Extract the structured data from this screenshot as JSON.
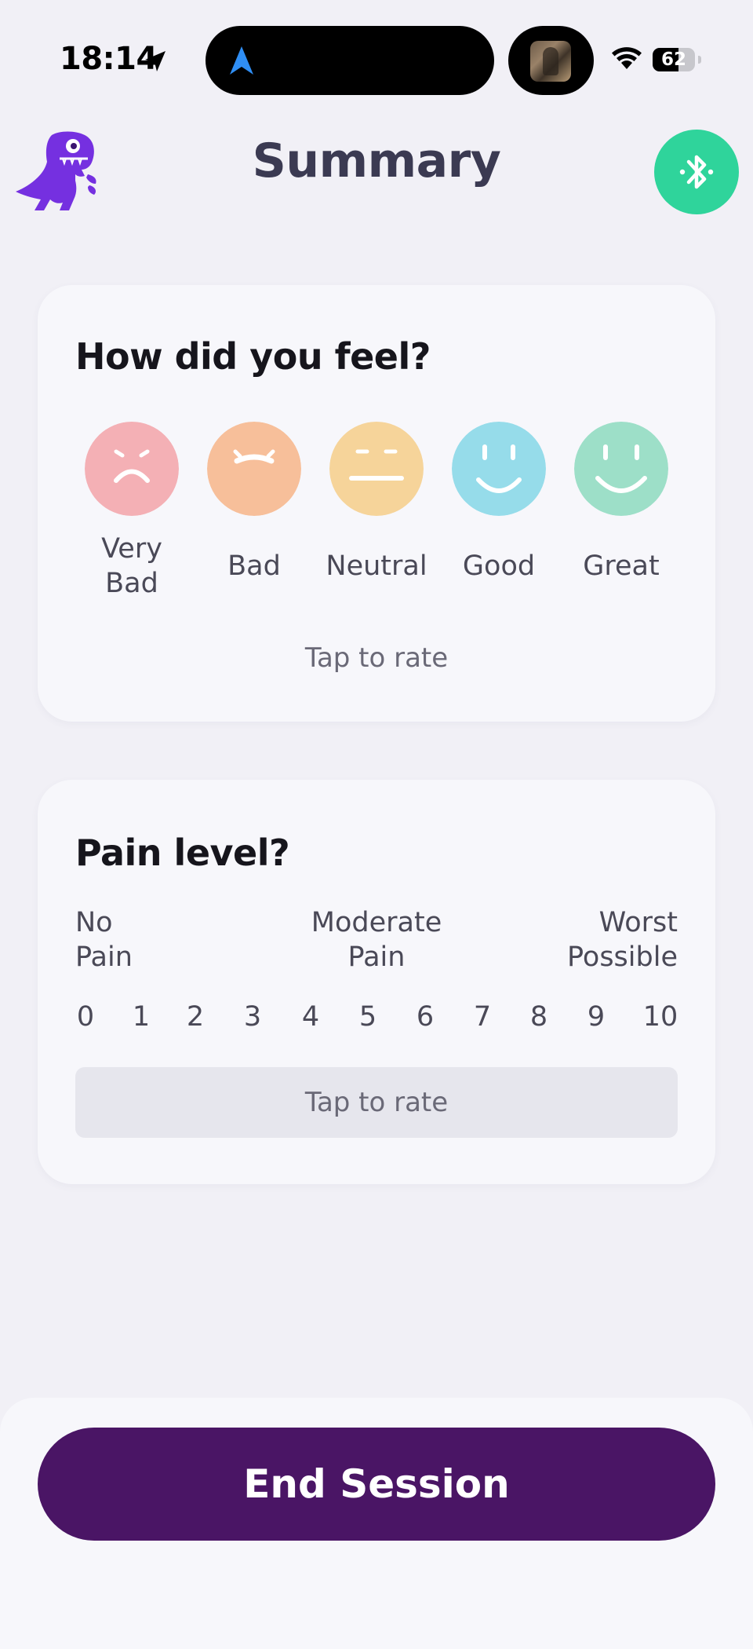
{
  "status_bar": {
    "time": "18:14",
    "battery": "62",
    "battery_fraction": 0.62
  },
  "header": {
    "title": "Summary",
    "logo_icon": "dino-logo-icon",
    "action_icon": "bluetooth-icon"
  },
  "feel_card": {
    "title": "How did you feel?",
    "moods": [
      {
        "label": "Very\nBad",
        "color": "#f4b0b5",
        "icon": "very-bad-face-icon"
      },
      {
        "label": "Bad",
        "color": "#f7bf9a",
        "icon": "bad-face-icon"
      },
      {
        "label": "Neutral",
        "color": "#f6d49a",
        "icon": "neutral-face-icon"
      },
      {
        "label": "Good",
        "color": "#96dcea",
        "icon": "good-face-icon"
      },
      {
        "label": "Great",
        "color": "#9ddfc8",
        "icon": "great-face-icon"
      }
    ],
    "hint": "Tap to rate"
  },
  "pain_card": {
    "title": "Pain level?",
    "left_label": "No\nPain",
    "mid_label": "Moderate\nPain",
    "right_label": "Worst\nPossible",
    "scale": [
      "0",
      "1",
      "2",
      "3",
      "4",
      "5",
      "6",
      "7",
      "8",
      "9",
      "10"
    ],
    "hint": "Tap to rate"
  },
  "footer": {
    "end_label": "End Session"
  },
  "colors": {
    "accent_green": "#2fd49b",
    "primary_purple": "#4a1565",
    "logo_purple": "#7530e0"
  }
}
